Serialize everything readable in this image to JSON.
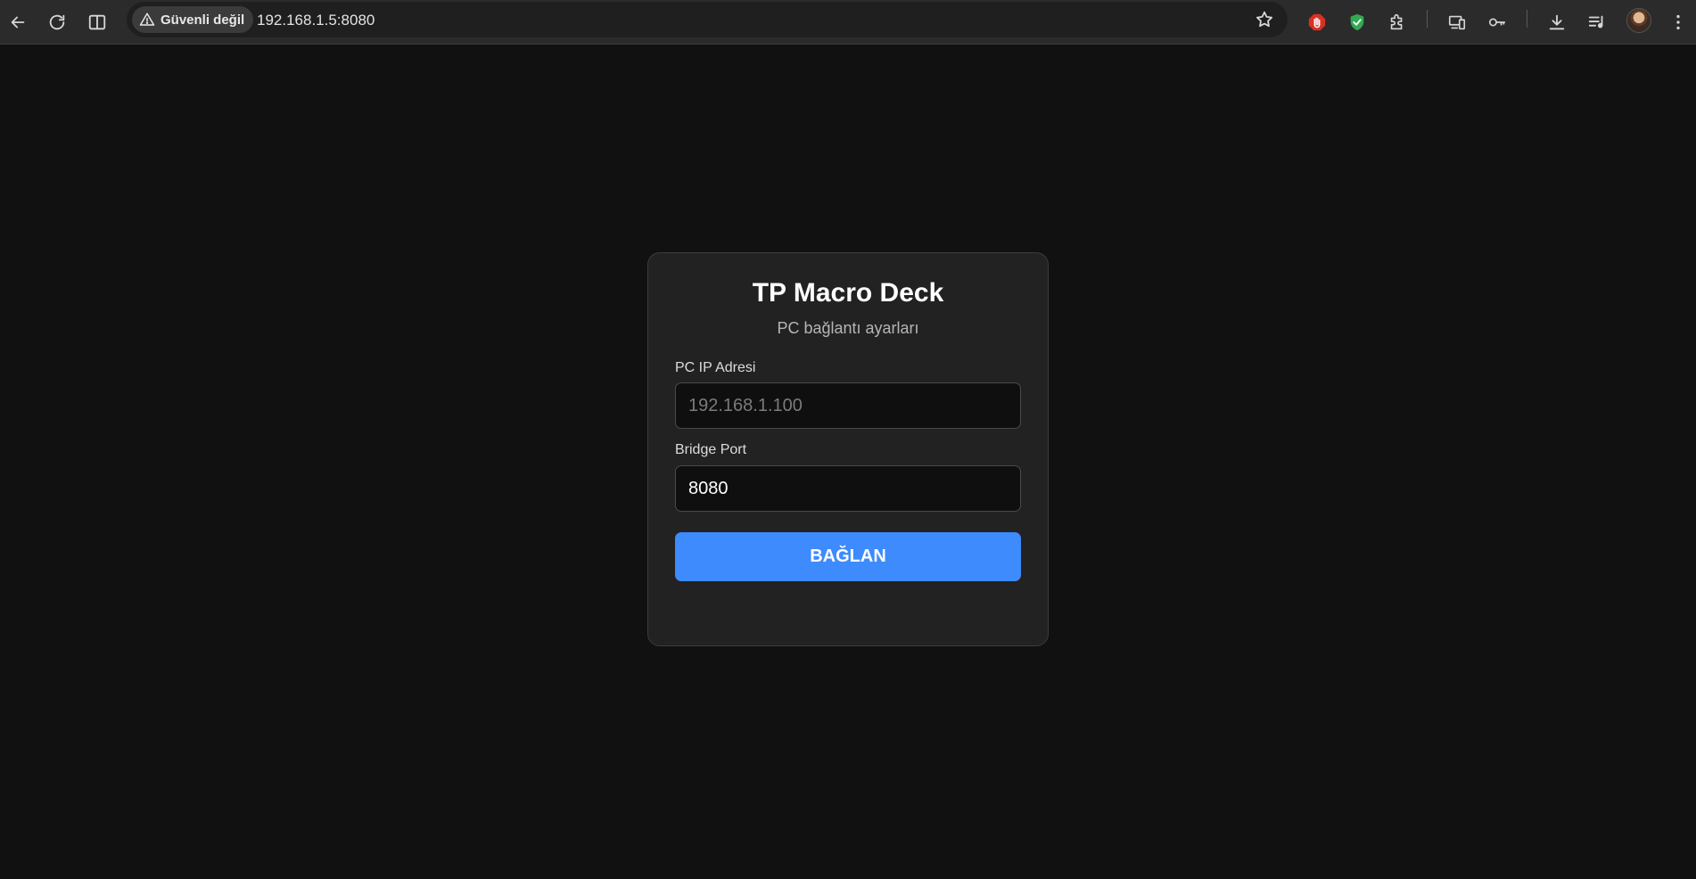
{
  "browser": {
    "security_label": "Güvenli değil",
    "url": "192.168.1.5:8080",
    "icons": {
      "back": "back-arrow-icon",
      "reload": "reload-icon",
      "split": "split-view-icon",
      "warning": "warning-triangle-icon",
      "star": "star-icon",
      "adblock": "adblock-hand-icon",
      "shield": "shield-check-icon",
      "extensions": "puzzle-icon",
      "cast": "cast-devices-icon",
      "passwords": "key-icon",
      "downloads": "download-icon",
      "media": "media-queue-icon",
      "menu": "kebab-menu-icon"
    },
    "colors": {
      "adblock": "#d93025",
      "shield": "#34a853"
    }
  },
  "card": {
    "title": "TP Macro Deck",
    "subtitle": "PC bağlantı ayarları",
    "ip_field": {
      "label": "PC IP Adresi",
      "placeholder": "192.168.1.100",
      "value": ""
    },
    "port_field": {
      "label": "Bridge Port",
      "placeholder": "",
      "value": "8080"
    },
    "connect_label": "BAĞLAN",
    "accent_color": "#3d8bfd"
  }
}
